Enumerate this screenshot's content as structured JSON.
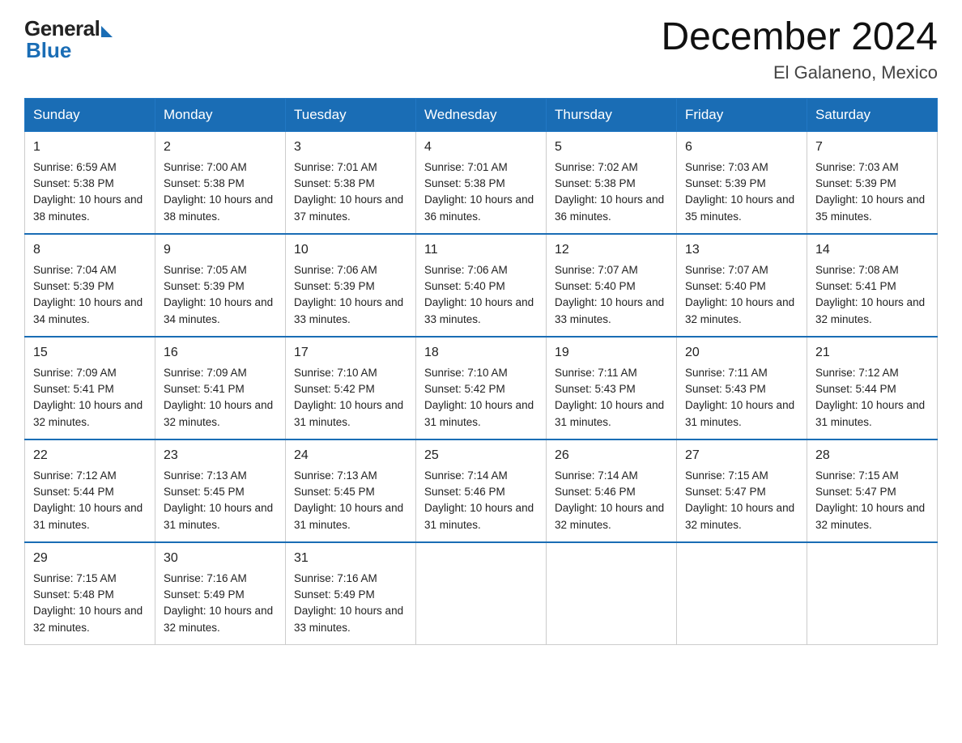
{
  "header": {
    "logo_general": "General",
    "logo_blue": "Blue",
    "month_title": "December 2024",
    "location": "El Galaneno, Mexico"
  },
  "days_of_week": [
    "Sunday",
    "Monday",
    "Tuesday",
    "Wednesday",
    "Thursday",
    "Friday",
    "Saturday"
  ],
  "weeks": [
    [
      {
        "day": 1,
        "sunrise": "6:59 AM",
        "sunset": "5:38 PM",
        "daylight": "10 hours and 38 minutes"
      },
      {
        "day": 2,
        "sunrise": "7:00 AM",
        "sunset": "5:38 PM",
        "daylight": "10 hours and 38 minutes"
      },
      {
        "day": 3,
        "sunrise": "7:01 AM",
        "sunset": "5:38 PM",
        "daylight": "10 hours and 37 minutes"
      },
      {
        "day": 4,
        "sunrise": "7:01 AM",
        "sunset": "5:38 PM",
        "daylight": "10 hours and 36 minutes"
      },
      {
        "day": 5,
        "sunrise": "7:02 AM",
        "sunset": "5:38 PM",
        "daylight": "10 hours and 36 minutes"
      },
      {
        "day": 6,
        "sunrise": "7:03 AM",
        "sunset": "5:39 PM",
        "daylight": "10 hours and 35 minutes"
      },
      {
        "day": 7,
        "sunrise": "7:03 AM",
        "sunset": "5:39 PM",
        "daylight": "10 hours and 35 minutes"
      }
    ],
    [
      {
        "day": 8,
        "sunrise": "7:04 AM",
        "sunset": "5:39 PM",
        "daylight": "10 hours and 34 minutes"
      },
      {
        "day": 9,
        "sunrise": "7:05 AM",
        "sunset": "5:39 PM",
        "daylight": "10 hours and 34 minutes"
      },
      {
        "day": 10,
        "sunrise": "7:06 AM",
        "sunset": "5:39 PM",
        "daylight": "10 hours and 33 minutes"
      },
      {
        "day": 11,
        "sunrise": "7:06 AM",
        "sunset": "5:40 PM",
        "daylight": "10 hours and 33 minutes"
      },
      {
        "day": 12,
        "sunrise": "7:07 AM",
        "sunset": "5:40 PM",
        "daylight": "10 hours and 33 minutes"
      },
      {
        "day": 13,
        "sunrise": "7:07 AM",
        "sunset": "5:40 PM",
        "daylight": "10 hours and 32 minutes"
      },
      {
        "day": 14,
        "sunrise": "7:08 AM",
        "sunset": "5:41 PM",
        "daylight": "10 hours and 32 minutes"
      }
    ],
    [
      {
        "day": 15,
        "sunrise": "7:09 AM",
        "sunset": "5:41 PM",
        "daylight": "10 hours and 32 minutes"
      },
      {
        "day": 16,
        "sunrise": "7:09 AM",
        "sunset": "5:41 PM",
        "daylight": "10 hours and 32 minutes"
      },
      {
        "day": 17,
        "sunrise": "7:10 AM",
        "sunset": "5:42 PM",
        "daylight": "10 hours and 31 minutes"
      },
      {
        "day": 18,
        "sunrise": "7:10 AM",
        "sunset": "5:42 PM",
        "daylight": "10 hours and 31 minutes"
      },
      {
        "day": 19,
        "sunrise": "7:11 AM",
        "sunset": "5:43 PM",
        "daylight": "10 hours and 31 minutes"
      },
      {
        "day": 20,
        "sunrise": "7:11 AM",
        "sunset": "5:43 PM",
        "daylight": "10 hours and 31 minutes"
      },
      {
        "day": 21,
        "sunrise": "7:12 AM",
        "sunset": "5:44 PM",
        "daylight": "10 hours and 31 minutes"
      }
    ],
    [
      {
        "day": 22,
        "sunrise": "7:12 AM",
        "sunset": "5:44 PM",
        "daylight": "10 hours and 31 minutes"
      },
      {
        "day": 23,
        "sunrise": "7:13 AM",
        "sunset": "5:45 PM",
        "daylight": "10 hours and 31 minutes"
      },
      {
        "day": 24,
        "sunrise": "7:13 AM",
        "sunset": "5:45 PM",
        "daylight": "10 hours and 31 minutes"
      },
      {
        "day": 25,
        "sunrise": "7:14 AM",
        "sunset": "5:46 PM",
        "daylight": "10 hours and 31 minutes"
      },
      {
        "day": 26,
        "sunrise": "7:14 AM",
        "sunset": "5:46 PM",
        "daylight": "10 hours and 32 minutes"
      },
      {
        "day": 27,
        "sunrise": "7:15 AM",
        "sunset": "5:47 PM",
        "daylight": "10 hours and 32 minutes"
      },
      {
        "day": 28,
        "sunrise": "7:15 AM",
        "sunset": "5:47 PM",
        "daylight": "10 hours and 32 minutes"
      }
    ],
    [
      {
        "day": 29,
        "sunrise": "7:15 AM",
        "sunset": "5:48 PM",
        "daylight": "10 hours and 32 minutes"
      },
      {
        "day": 30,
        "sunrise": "7:16 AM",
        "sunset": "5:49 PM",
        "daylight": "10 hours and 32 minutes"
      },
      {
        "day": 31,
        "sunrise": "7:16 AM",
        "sunset": "5:49 PM",
        "daylight": "10 hours and 33 minutes"
      },
      null,
      null,
      null,
      null
    ]
  ]
}
